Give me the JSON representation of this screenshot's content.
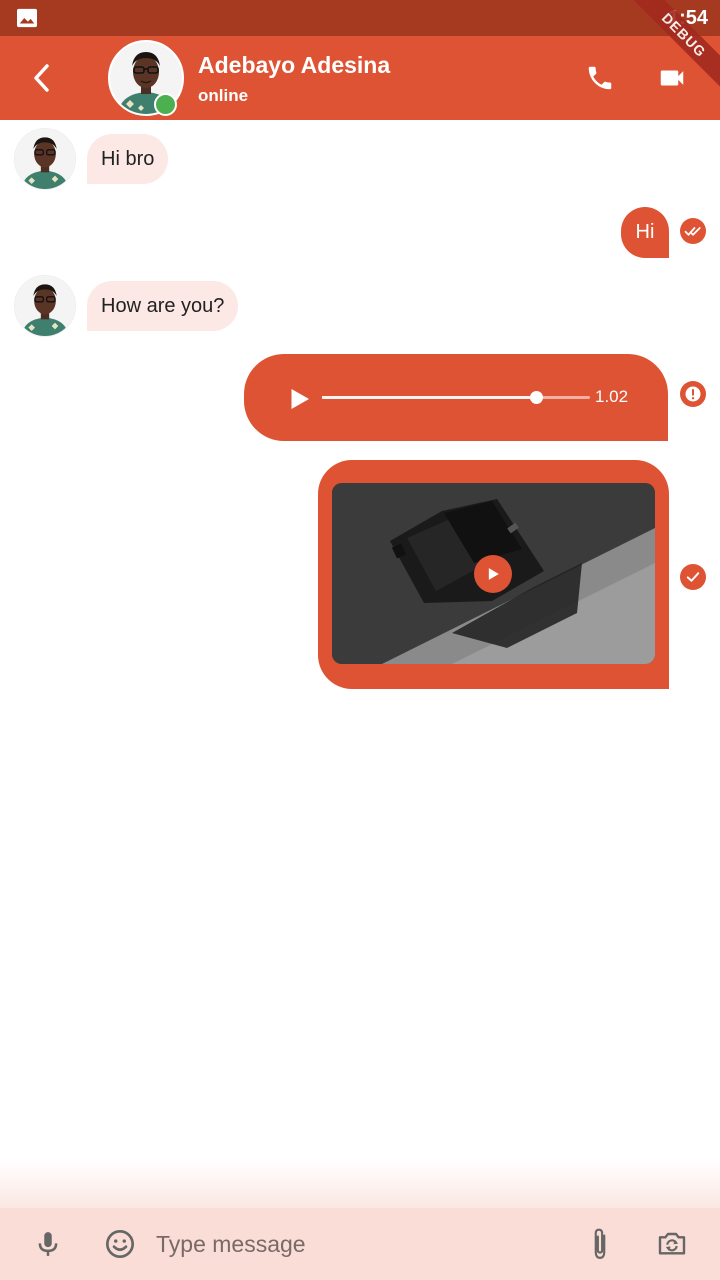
{
  "status_bar": {
    "time": "1:54",
    "icon": "image-icon"
  },
  "debug_banner": "DEBUG",
  "header": {
    "contact_name": "Adebayo Adesina",
    "contact_status": "online",
    "back_icon": "chevron-left-icon",
    "call_icon": "phone-icon",
    "video_icon": "videocam-icon"
  },
  "messages": [
    {
      "type": "text",
      "direction": "incoming",
      "text": "Hi bro"
    },
    {
      "type": "text",
      "direction": "outgoing",
      "text": "Hi",
      "status": "read"
    },
    {
      "type": "text",
      "direction": "incoming",
      "text": "How are you?"
    },
    {
      "type": "audio",
      "direction": "outgoing",
      "duration": "1.02",
      "progress": 0.8,
      "status": "error"
    },
    {
      "type": "video",
      "direction": "outgoing",
      "status": "sent"
    }
  ],
  "composer": {
    "placeholder": "Type message",
    "value": "",
    "mic_icon": "mic-icon",
    "emoji_icon": "emoji-icon",
    "attach_icon": "attach-icon",
    "camera_icon": "camera-switch-icon"
  },
  "colors": {
    "primary": "#dd5333",
    "status_bar": "#a63a20",
    "incoming_bubble": "#fce9e5",
    "online": "#4caf50",
    "composer_bg": "#f9ddd6"
  }
}
